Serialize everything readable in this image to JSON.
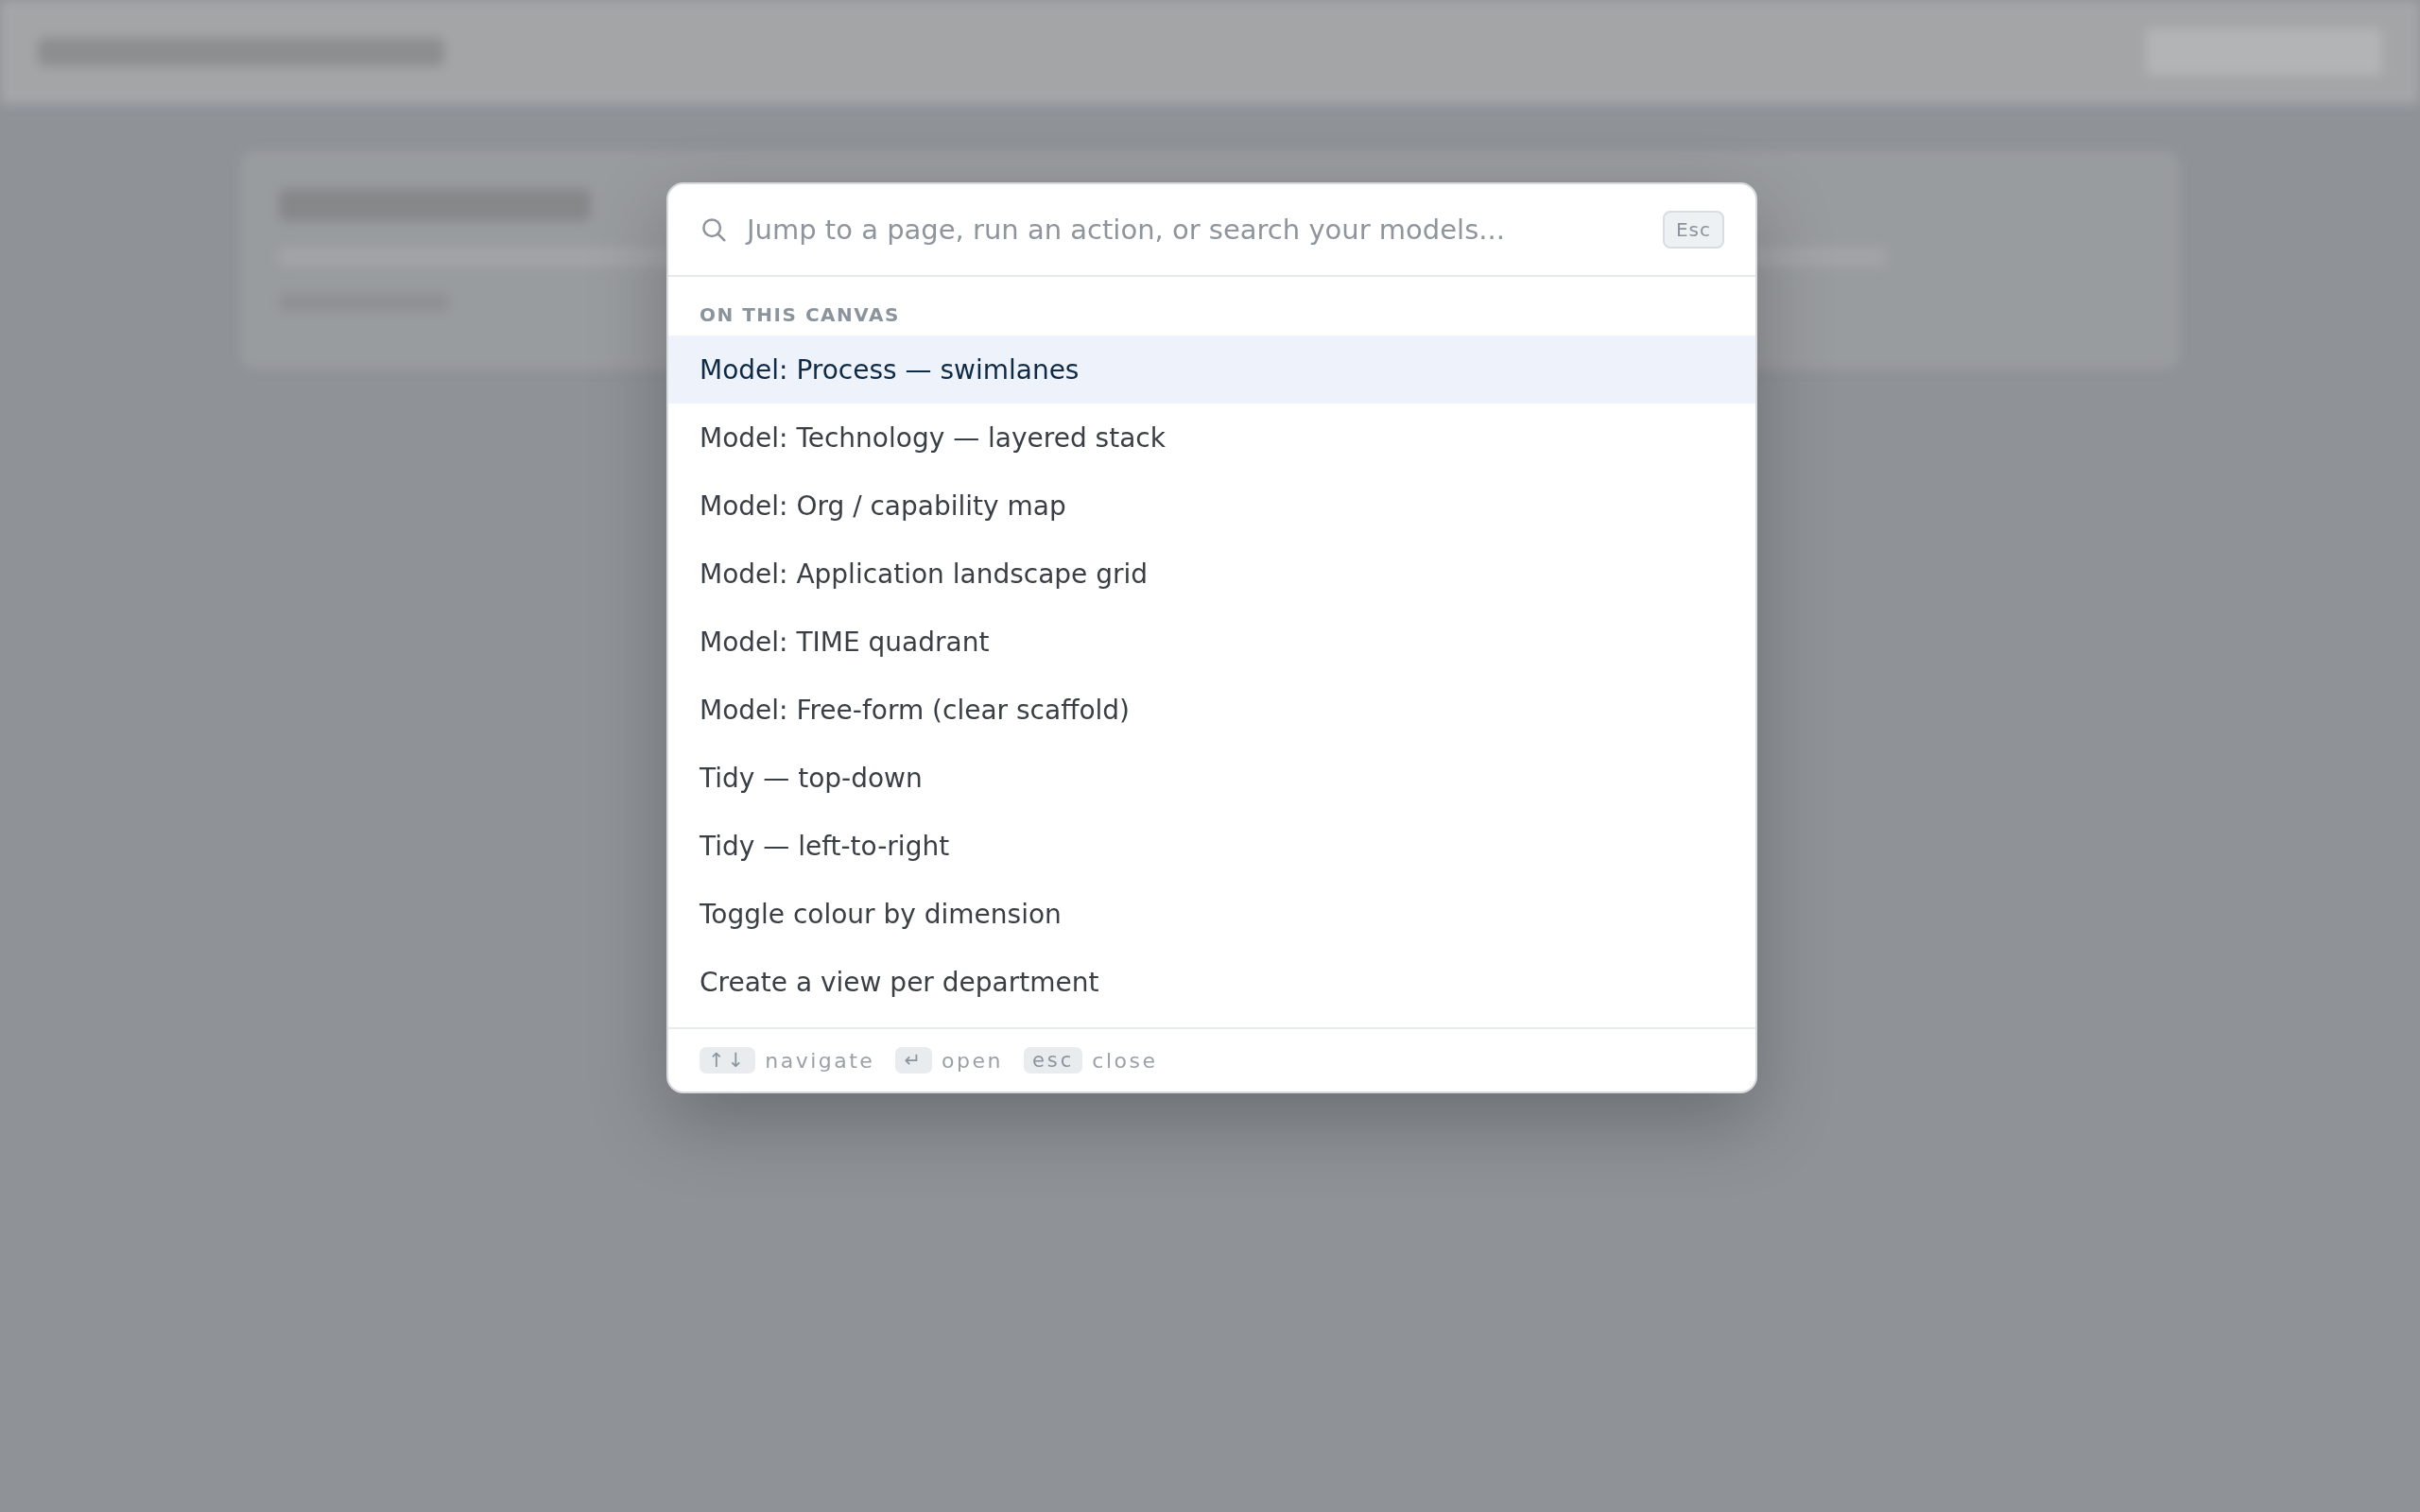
{
  "search": {
    "placeholder": "Jump to a page, run an action, or search your models...",
    "key": "Esc"
  },
  "section": {
    "label": "ON THIS CANVAS"
  },
  "items": [
    {
      "label": "Model: Process — swimlanes",
      "selected": true
    },
    {
      "label": "Model: Technology — layered stack",
      "selected": false
    },
    {
      "label": "Model: Org / capability map",
      "selected": false
    },
    {
      "label": "Model: Application landscape grid",
      "selected": false
    },
    {
      "label": "Model: TIME quadrant",
      "selected": false
    },
    {
      "label": "Model: Free-form (clear scaffold)",
      "selected": false
    },
    {
      "label": "Tidy — top-down",
      "selected": false
    },
    {
      "label": "Tidy — left-to-right",
      "selected": false
    },
    {
      "label": "Toggle colour by dimension",
      "selected": false
    },
    {
      "label": "Create a view per department",
      "selected": false
    }
  ],
  "hints": [
    {
      "key": "↑↓",
      "label": "navigate"
    },
    {
      "key": "↵",
      "label": "open"
    },
    {
      "key": "esc",
      "label": "close"
    }
  ]
}
